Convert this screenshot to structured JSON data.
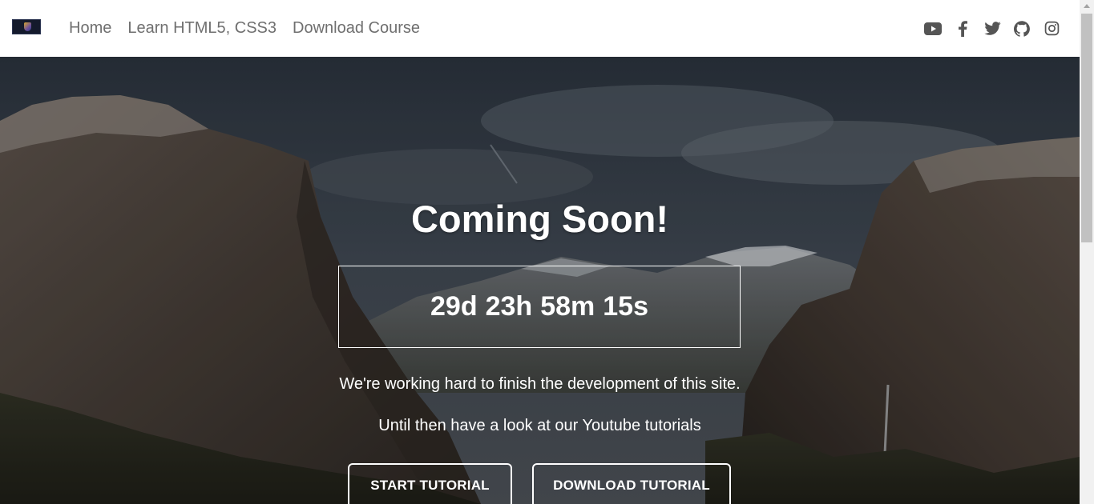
{
  "nav": {
    "links": [
      {
        "label": "Home"
      },
      {
        "label": "Learn HTML5, CSS3"
      },
      {
        "label": "Download Course"
      }
    ],
    "social": [
      "youtube-icon",
      "facebook-icon",
      "twitter-icon",
      "github-icon",
      "instagram-icon"
    ]
  },
  "hero": {
    "title": "Coming Soon!",
    "countdown": {
      "days": "29d",
      "hours": "23h",
      "minutes": "58m",
      "seconds": "15s"
    },
    "description_line1": "We're working hard to finish the development of this site.",
    "description_line2": "Until then have a look at our Youtube tutorials",
    "buttons": {
      "start": "START TUTORIAL",
      "download": "DOWNLOAD TUTORIAL"
    }
  },
  "colors": {
    "nav_text": "#6f6f6f",
    "icon": "#555555",
    "hero_text": "#ffffff"
  }
}
